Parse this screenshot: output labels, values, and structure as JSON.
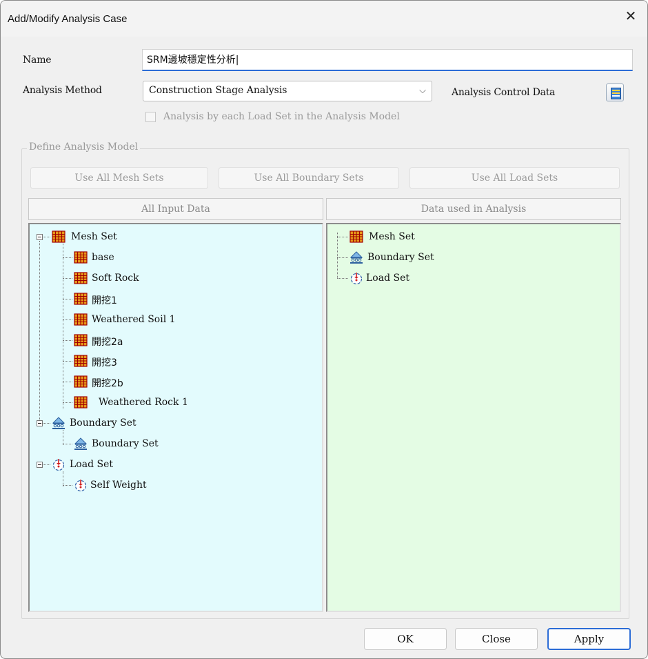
{
  "dialog": {
    "title": "Add/Modify Analysis Case",
    "close_glyph": "✕"
  },
  "form": {
    "name_label": "Name",
    "name_value": "SRM邊坡穩定性分析|",
    "method_label": "Analysis Method",
    "method_value": "Construction Stage Analysis",
    "control_label": "Analysis Control Data",
    "each_load_set_label": "Analysis by each Load Set in the Analysis Model"
  },
  "define_model": {
    "group_label": "Define Analysis Model",
    "use_mesh_label": "Use All Mesh Sets",
    "use_boundary_label": "Use All Boundary Sets",
    "use_load_label": "Use All Load Sets",
    "left_header": "All Input Data",
    "right_header": "Data used in Analysis"
  },
  "left_tree": {
    "mesh_set": "Mesh Set",
    "mesh_items": [
      "base",
      "Soft Rock",
      "開挖1",
      "Weathered Soil 1",
      "開挖2a",
      "開挖3",
      "開挖2b",
      "Weathered Rock 1"
    ],
    "boundary_set": "Boundary Set",
    "boundary_items": [
      "Boundary Set"
    ],
    "load_set": "Load Set",
    "load_items": [
      "Self Weight"
    ]
  },
  "right_tree": {
    "mesh_set": "Mesh Set",
    "boundary_set": "Boundary Set",
    "load_set": "Load Set"
  },
  "footer": {
    "ok": "OK",
    "close": "Close",
    "apply": "Apply"
  },
  "colors": {
    "accent": "#2b6cd6",
    "left_panel": "#e3fbfd",
    "right_panel": "#e4fce4",
    "mesh_icon": "#e89a1a"
  },
  "icons": [
    "close-icon",
    "chevron-down-icon",
    "analysis-control-icon",
    "mesh-set-icon",
    "boundary-set-icon",
    "load-set-icon"
  ]
}
